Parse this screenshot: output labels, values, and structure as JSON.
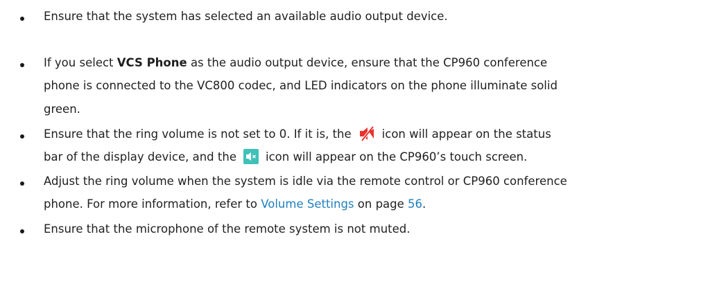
{
  "items": [
    {
      "text": "Ensure that the system has selected an available audio output device."
    },
    {
      "pre": "If you select ",
      "bold": "VCS Phone",
      "mid": " as the audio output device, ensure that the CP960 conference",
      "line2": "phone is connected to the VC800 codec, and LED indicators on the phone illuminate solid",
      "line3": "green."
    },
    {
      "a": "Ensure that the ring volume is not set to 0. If it is, the",
      "icon1": "speaker-muted-red-icon",
      "b": "icon will appear on the status",
      "c": "bar of the display device, and the",
      "icon2": "speaker-muted-touchscreen-icon",
      "d": "icon will appear on the CP960’s touch screen."
    },
    {
      "a": "Adjust the ring volume when the system is idle via the remote control or CP960 conference",
      "b": "phone. For more information, refer to ",
      "link": "Volume Settings",
      "c": " on page ",
      "page": "56",
      "d": "."
    },
    {
      "text": "Ensure that the microphone of the remote system is not muted."
    }
  ],
  "colors": {
    "link": "#1f7fbf",
    "icon_red": "#e8322f",
    "icon_teal": "#3fc1b8"
  }
}
